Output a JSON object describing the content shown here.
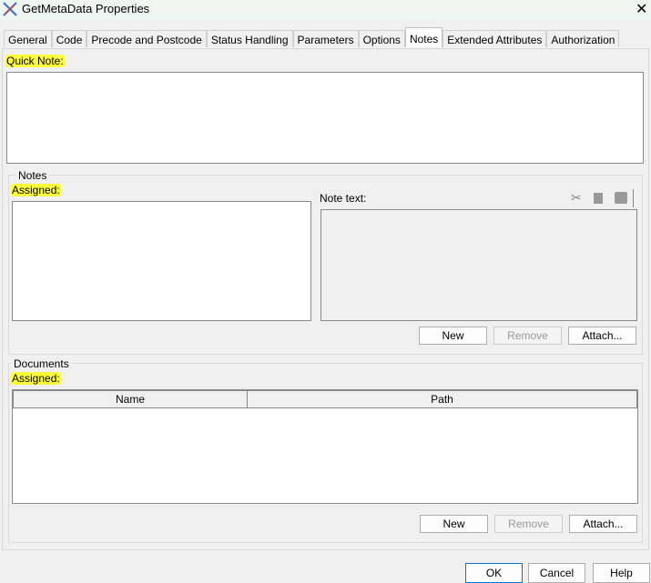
{
  "window": {
    "title": "GetMetaData Properties",
    "close": "✕"
  },
  "tabs": [
    "General",
    "Code",
    "Precode and Postcode",
    "Status Handling",
    "Parameters",
    "Options",
    "Notes",
    "Extended Attributes",
    "Authorization"
  ],
  "quick_note": {
    "label": "Quick Note:",
    "value": ""
  },
  "notes": {
    "legend": "Notes",
    "assigned": "Assigned:",
    "note_text": "Note text:",
    "new": "New",
    "remove": "Remove",
    "attach": "Attach..."
  },
  "documents": {
    "legend": "Documents",
    "assigned": "Assigned:",
    "columns": [
      "Name",
      "Path"
    ],
    "new": "New",
    "remove": "Remove",
    "attach": "Attach..."
  },
  "footer": {
    "ok": "OK",
    "cancel": "Cancel",
    "help": "Help"
  }
}
